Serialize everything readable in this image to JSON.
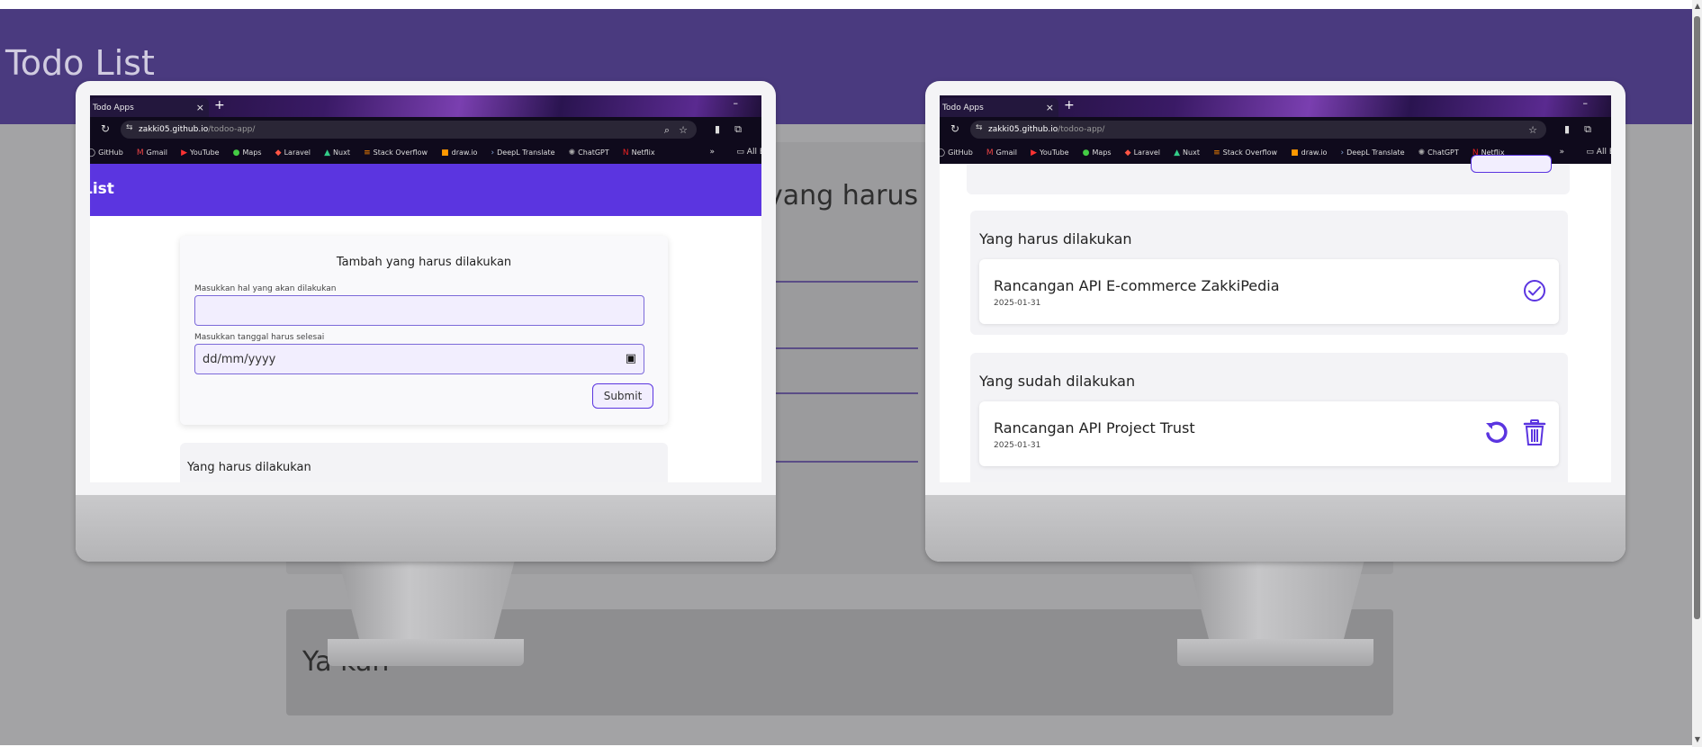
{
  "page": {
    "title": "Todo List",
    "background_heading": "yang harus dil",
    "background_card_text": "Ya                 kan"
  },
  "browser": {
    "tab_title": "Todo Apps",
    "tab_close": "×",
    "new_tab": "+",
    "minimize": "–",
    "url_host": "zakki05.github.io",
    "url_path": "/todoo-app/",
    "bookmarks": [
      "GitHub",
      "Gmail",
      "YouTube",
      "Maps",
      "Laravel",
      "Nuxt",
      "Stack Overflow",
      "draw.io",
      "DeepL Translate",
      "ChatGPT",
      "Netflix"
    ],
    "bookmarks_more": "»",
    "all_bookmarks": "All B"
  },
  "left_app": {
    "header_title": "List",
    "form": {
      "title": "Tambah yang harus dilakukan",
      "task_label": "Masukkan hal yang akan dilakukan",
      "task_value": "",
      "date_label": "Masukkan tanggal harus selesai",
      "date_placeholder": "dd/mm/yyyy",
      "submit_label": "Submit"
    },
    "todo_section_title": "Yang harus dilakukan"
  },
  "right_app": {
    "todo_section": {
      "title": "Yang harus dilakukan",
      "items": [
        {
          "name": "Rancangan API E-commerce ZakkiPedia",
          "date": "2025-01-31"
        }
      ]
    },
    "done_section": {
      "title": "Yang sudah dilakukan",
      "items": [
        {
          "name": "Rancangan API Project Trust",
          "date": "2025-01-31"
        }
      ]
    }
  },
  "colors": {
    "accent": "#5b35e0",
    "page_header": "#4a3a7f",
    "overlay": "#a3a3a5"
  }
}
